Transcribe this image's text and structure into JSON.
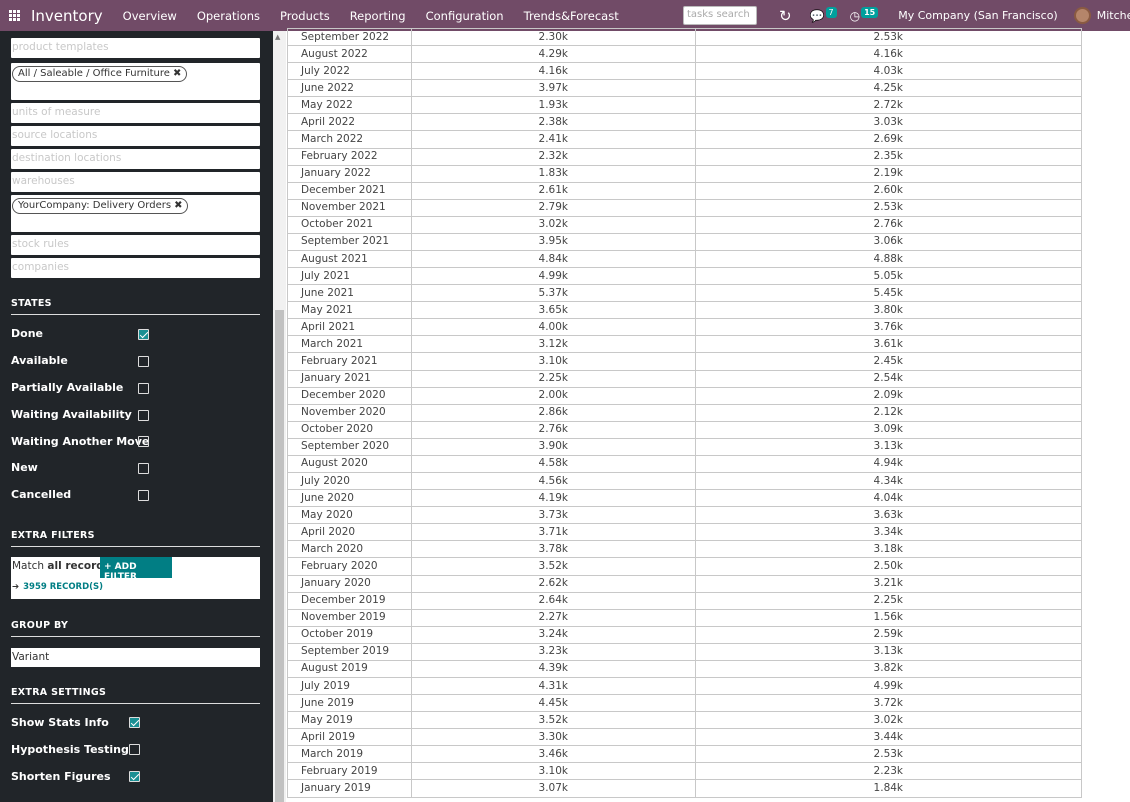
{
  "navbar": {
    "brand": "Inventory",
    "menu": [
      "Overview",
      "Operations",
      "Products",
      "Reporting",
      "Configuration",
      "Trends&Forecast"
    ],
    "search_placeholder": "tasks search",
    "chat_badge": "7",
    "activity_badge": "15",
    "company": "My Company (San Francisco)",
    "user": "Mitchell Adm"
  },
  "sidebar": {
    "product_templates_placeholder": "product templates",
    "category_tag": "All / Saleable / Office Furniture",
    "units_placeholder": "units of measure",
    "source_placeholder": "source locations",
    "destination_placeholder": "destination locations",
    "warehouses_placeholder": "warehouses",
    "picking_tag": "YourCompany: Delivery Orders",
    "stock_rules_placeholder": "stock rules",
    "companies_placeholder": "companies",
    "states_title": "STATES",
    "states": [
      {
        "label": "Done",
        "checked": true
      },
      {
        "label": "Available",
        "checked": false
      },
      {
        "label": "Partially Available",
        "checked": false
      },
      {
        "label": "Waiting Availability",
        "checked": false
      },
      {
        "label": "Waiting Another Move",
        "checked": false
      },
      {
        "label": "New",
        "checked": false
      },
      {
        "label": "Cancelled",
        "checked": false
      }
    ],
    "extra_filters_title": "EXTRA FILTERS",
    "match_prefix": "Match ",
    "match_bold": "all records",
    "add_filter_label": "+ ADD FILTER",
    "records_label": "3959 RECORD(S)",
    "group_by_title": "GROUP BY",
    "group_by_value": "Variant",
    "extra_settings_title": "EXTRA SETTINGS",
    "settings": [
      {
        "label": "Show Stats Info",
        "checked": true
      },
      {
        "label": "Hypothesis Testing",
        "checked": false
      },
      {
        "label": "Shorten Figures",
        "checked": true
      }
    ]
  },
  "table": {
    "rows": [
      [
        "September 2022",
        "2.30k",
        "2.53k"
      ],
      [
        "August 2022",
        "4.29k",
        "4.16k"
      ],
      [
        "July 2022",
        "4.16k",
        "4.03k"
      ],
      [
        "June 2022",
        "3.97k",
        "4.25k"
      ],
      [
        "May 2022",
        "1.93k",
        "2.72k"
      ],
      [
        "April 2022",
        "2.38k",
        "3.03k"
      ],
      [
        "March 2022",
        "2.41k",
        "2.69k"
      ],
      [
        "February 2022",
        "2.32k",
        "2.35k"
      ],
      [
        "January 2022",
        "1.83k",
        "2.19k"
      ],
      [
        "December 2021",
        "2.61k",
        "2.60k"
      ],
      [
        "November 2021",
        "2.79k",
        "2.53k"
      ],
      [
        "October 2021",
        "3.02k",
        "2.76k"
      ],
      [
        "September 2021",
        "3.95k",
        "3.06k"
      ],
      [
        "August 2021",
        "4.84k",
        "4.88k"
      ],
      [
        "July 2021",
        "4.99k",
        "5.05k"
      ],
      [
        "June 2021",
        "5.37k",
        "5.45k"
      ],
      [
        "May 2021",
        "3.65k",
        "3.80k"
      ],
      [
        "April 2021",
        "4.00k",
        "3.76k"
      ],
      [
        "March 2021",
        "3.12k",
        "3.61k"
      ],
      [
        "February 2021",
        "3.10k",
        "2.45k"
      ],
      [
        "January 2021",
        "2.25k",
        "2.54k"
      ],
      [
        "December 2020",
        "2.00k",
        "2.09k"
      ],
      [
        "November 2020",
        "2.86k",
        "2.12k"
      ],
      [
        "October 2020",
        "2.76k",
        "3.09k"
      ],
      [
        "September 2020",
        "3.90k",
        "3.13k"
      ],
      [
        "August 2020",
        "4.58k",
        "4.94k"
      ],
      [
        "July 2020",
        "4.56k",
        "4.34k"
      ],
      [
        "June 2020",
        "4.19k",
        "4.04k"
      ],
      [
        "May 2020",
        "3.73k",
        "3.63k"
      ],
      [
        "April 2020",
        "3.71k",
        "3.34k"
      ],
      [
        "March 2020",
        "3.78k",
        "3.18k"
      ],
      [
        "February 2020",
        "3.52k",
        "2.50k"
      ],
      [
        "January 2020",
        "2.62k",
        "3.21k"
      ],
      [
        "December 2019",
        "2.64k",
        "2.25k"
      ],
      [
        "November 2019",
        "2.27k",
        "1.56k"
      ],
      [
        "October 2019",
        "3.24k",
        "2.59k"
      ],
      [
        "September 2019",
        "3.23k",
        "3.13k"
      ],
      [
        "August 2019",
        "4.39k",
        "3.82k"
      ],
      [
        "July 2019",
        "4.31k",
        "4.99k"
      ],
      [
        "June 2019",
        "4.45k",
        "3.72k"
      ],
      [
        "May 2019",
        "3.52k",
        "3.02k"
      ],
      [
        "April 2019",
        "3.30k",
        "3.44k"
      ],
      [
        "March 2019",
        "3.46k",
        "2.53k"
      ],
      [
        "February 2019",
        "3.10k",
        "2.23k"
      ],
      [
        "January 2019",
        "3.07k",
        "1.84k"
      ]
    ]
  }
}
